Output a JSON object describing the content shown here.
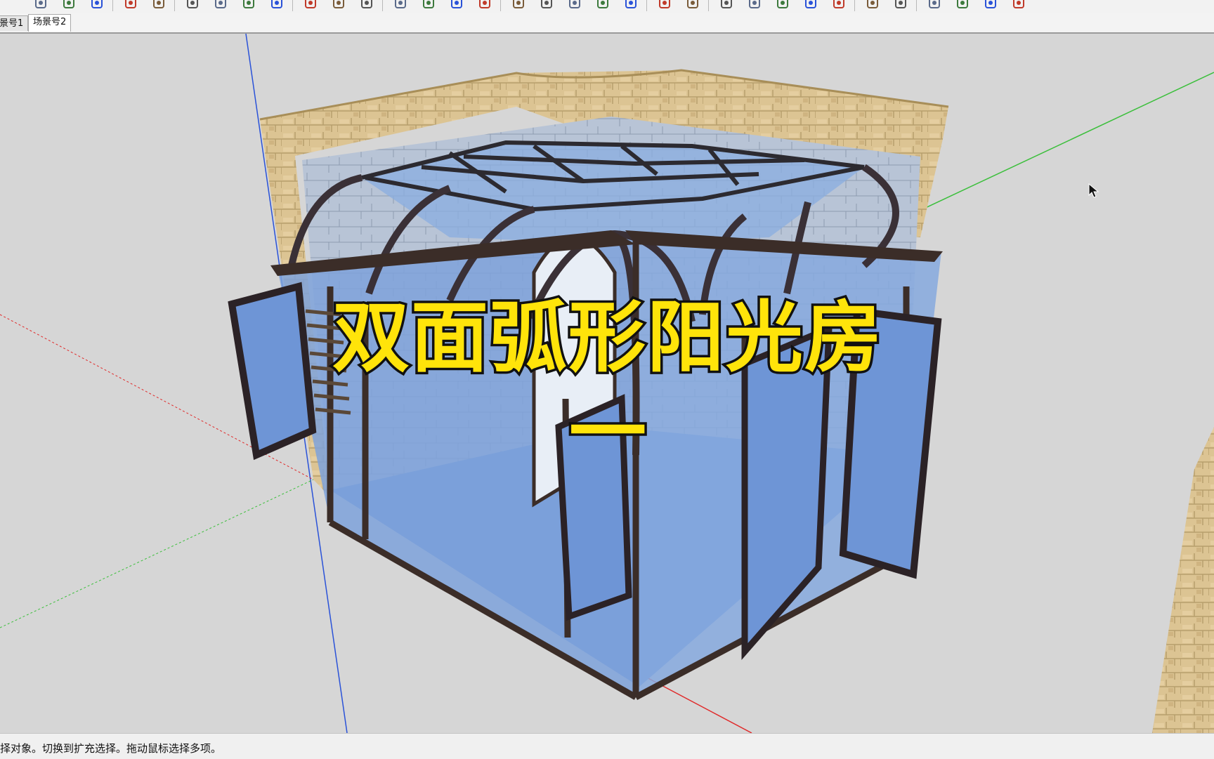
{
  "toolbar": {
    "icons": [
      "paint-bucket-icon",
      "components-icon",
      "geo-location-icon",
      "shape-icon",
      "push-pull-icon",
      "layer-icon",
      "axes-icon",
      "move-icon",
      "rotate-icon",
      "scale-icon",
      "offset-icon",
      "tape-measure-icon",
      "orbit-icon",
      "pan-icon",
      "zoom-icon",
      "section-plane-icon",
      "view-iso-icon",
      "view-top-icon",
      "view-front-icon",
      "view-right-icon",
      "view-back-icon",
      "walk-icon",
      "hand-icon",
      "sandbox-icon",
      "stamp-icon",
      "drape-icon",
      "add-detail-icon",
      "flip-edge-icon",
      "export-icon",
      "import-icon",
      "window-icon",
      "camera-icon",
      "settings-icon",
      "photo-icon"
    ]
  },
  "scene_tabs": [
    {
      "label": "景号1",
      "active": false
    },
    {
      "label": "场景号2",
      "active": true
    }
  ],
  "overlay": {
    "title": "双面弧形阳光房",
    "subtitle": "一"
  },
  "status_bar": {
    "text": "择对象。切换到扩充选择。拖动鼠标选择多项。"
  },
  "colors": {
    "title_fill": "#ffe40a",
    "title_stroke": "#111111",
    "glass": "#7ea2da",
    "frame": "#3b2d28",
    "stone": "#d8c18f",
    "axis_red": "#e02a2a",
    "axis_green": "#3bbf3b",
    "axis_blue": "#2a52d8"
  }
}
